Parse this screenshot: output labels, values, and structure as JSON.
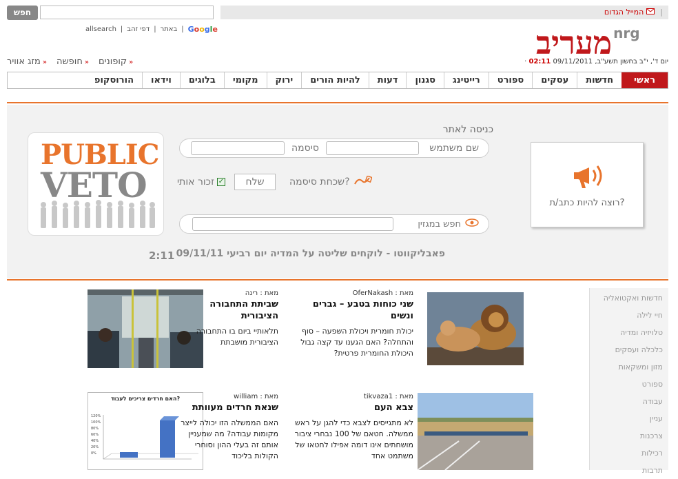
{
  "header": {
    "mail_label": "המייל הגדום",
    "search_button": "חפש",
    "search_options": {
      "google": "Google",
      "site": "באתר",
      "dapei_zahav": "דפי זהב",
      "allsearch": "allsearch"
    },
    "logo_text": "מעריב",
    "logo_nrg": "nrg",
    "time": "02:11",
    "date_text": "· יום ד', י\"ב בחשון תשע\"ב, 09/11/2011",
    "quick_links": [
      "מזג אוויר",
      "חופשה",
      "קופונים"
    ]
  },
  "nav": {
    "items": [
      "ראשי",
      "חדשות",
      "עסקים",
      "ספורט",
      "רייטינג",
      "סגנון",
      "דעות",
      "להיות הורים",
      "ירוק",
      "מקומי",
      "בלוגים",
      "וידאו",
      "הורוסקופ"
    ]
  },
  "login": {
    "title": "כניסה לאתר",
    "username_label": "שם משתמש",
    "password_label": "סיסמה",
    "forgot": "שכחת סיסמה?",
    "send": "שלח",
    "remember": "זכור אותי",
    "magazine_search": "חפש במגזין",
    "writer": "רוצה להיות כתב/ת?",
    "veto_line1": "PUBLIC",
    "veto_line2": "VETO"
  },
  "headline": {
    "text": "פאבליקווטו - לוקחים שליטה על המדיה יום רביעי 09/11/11",
    "time": "2:11"
  },
  "sidebar": {
    "items": [
      "חדשות ואקטואליה",
      "חיי לילה",
      "טלויזיה ומדיה",
      "כלכלה ועסקים",
      "מזון ומשקאות",
      "ספורט",
      "עבודה",
      "עניין",
      "צרכנות",
      "רכילות",
      "תרבות"
    ]
  },
  "articles": [
    {
      "by_label": "מאת :",
      "author": "OferNakash",
      "title": "שני כוחות בטבע – גברים ונשים",
      "body": "יכולת חומרית ויכולת השפעה – סוף והתחלה? האם הגענו עד קצה גבול היכולת החומרית פרטית?"
    },
    {
      "by_label": "מאת :",
      "author": "רינה",
      "title": "שביתת התחבורה הציבורית",
      "body": "תלאותיי ביום בו התחבורה הציבורית מושבתת"
    },
    {
      "by_label": "מאת :",
      "author": "tikvaza1",
      "title": "צבא העם",
      "body": "לא מתגייסים לצבא כדי להגן על ראש ממשלה. חטאם של 100 נבחרי ציבור מושחתים אינו דומה אפילו לחטאו של משתמט אחד"
    },
    {
      "by_label": "מאת :",
      "author": "william",
      "title": "שנאת חרדים מעוותת",
      "body": "האם הממשלה הזו יכולה לייצר מקומות עבודה? מה שמעניין אותם זה בעלי ההון וסוחרי הקולות בליכוד"
    }
  ],
  "mini_chart": {
    "title": "האם חרדים צריכים לעבוד?",
    "ticks": [
      "120%",
      "100%",
      "80%",
      "60%",
      "40%",
      "20%",
      "0%"
    ]
  },
  "colors": {
    "brand": "#c0181b",
    "accent": "#e8742c"
  }
}
